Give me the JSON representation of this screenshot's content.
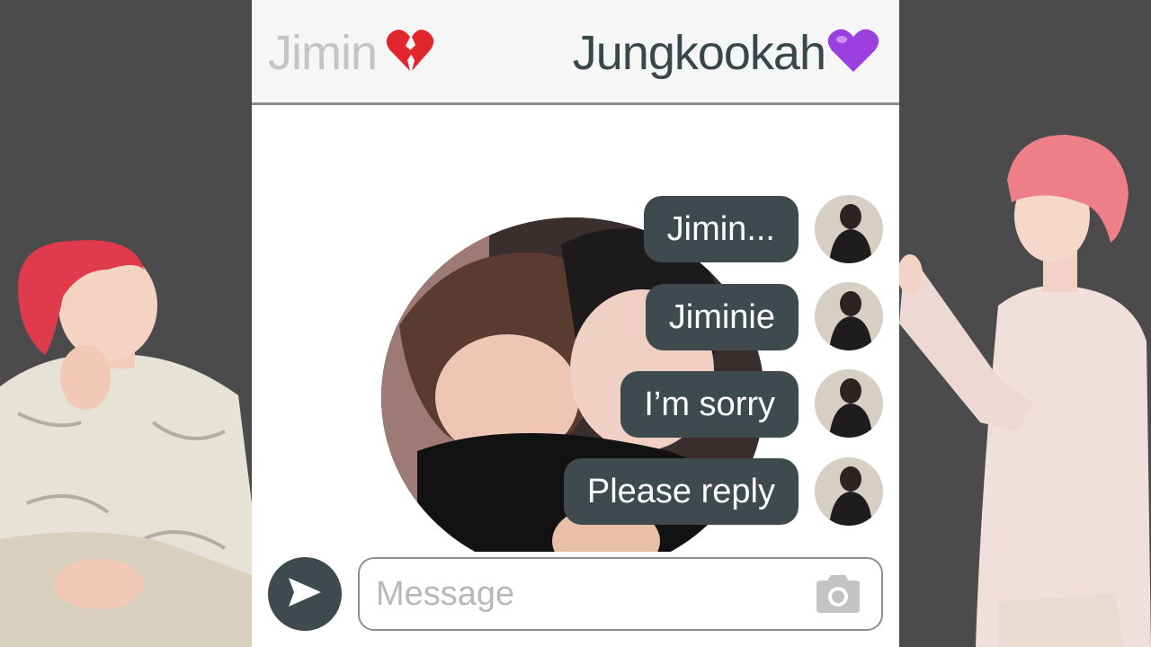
{
  "header": {
    "left_name": "Jimin",
    "left_emoji": "broken-heart-icon",
    "right_name": "Jungkookah",
    "right_emoji": "purple-heart-icon"
  },
  "messages": [
    {
      "text": "Jimin..."
    },
    {
      "text": "Jiminie"
    },
    {
      "text": "I’m sorry"
    },
    {
      "text": "Please reply"
    }
  ],
  "composer": {
    "placeholder": "Message",
    "send_icon": "send-arrow-icon",
    "camera_icon": "camera-icon"
  },
  "colors": {
    "bubble": "#3e4a4d",
    "header_bg": "#f6f6f6",
    "side_bg": "#4b4b4b"
  }
}
